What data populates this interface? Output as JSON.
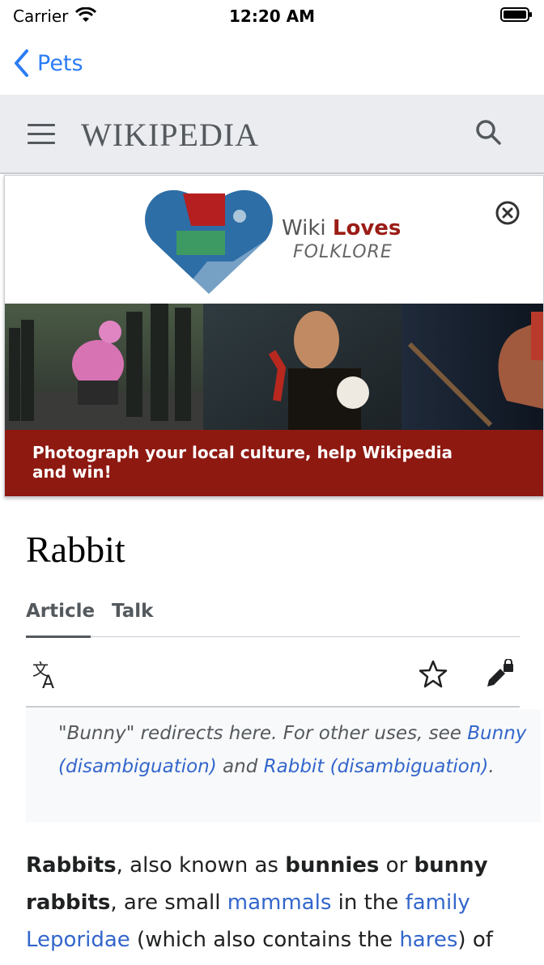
{
  "status": {
    "carrier": "Carrier",
    "time": "12:20 AM"
  },
  "nav": {
    "back_label": "Pets"
  },
  "header": {
    "wordmark": "WIKIPEDIA"
  },
  "banner": {
    "logo_wiki": "Wiki",
    "logo_loves": "Loves",
    "logo_sub": "FOLKLORE",
    "text": "Photograph your local culture, help Wikipedia and win!"
  },
  "article": {
    "title": "Rabbit",
    "tabs": [
      "Article",
      "Talk"
    ],
    "hatnote": {
      "pre": "\"Bunny\" redirects here. For other uses, see ",
      "link1": "Bunny (disambiguation)",
      "mid": " and ",
      "link2": "Rabbit (disambiguation)",
      "post": "."
    },
    "para": {
      "b1": "Rabbits",
      "t1": ", also known as ",
      "b2": "bunnies",
      "t2": " or ",
      "b3": "bunny rabbits",
      "t3": ", are small ",
      "l1": "mammals",
      "t4": " in the ",
      "l2": "family",
      "t5": " ",
      "l3": "Leporidae",
      "t6": " (which also contains the ",
      "l4": "hares",
      "t7": ") of"
    }
  },
  "colors": {
    "link": "#3366cc",
    "ios_blue": "#2b7cf6",
    "banner_red": "#8e1911"
  }
}
